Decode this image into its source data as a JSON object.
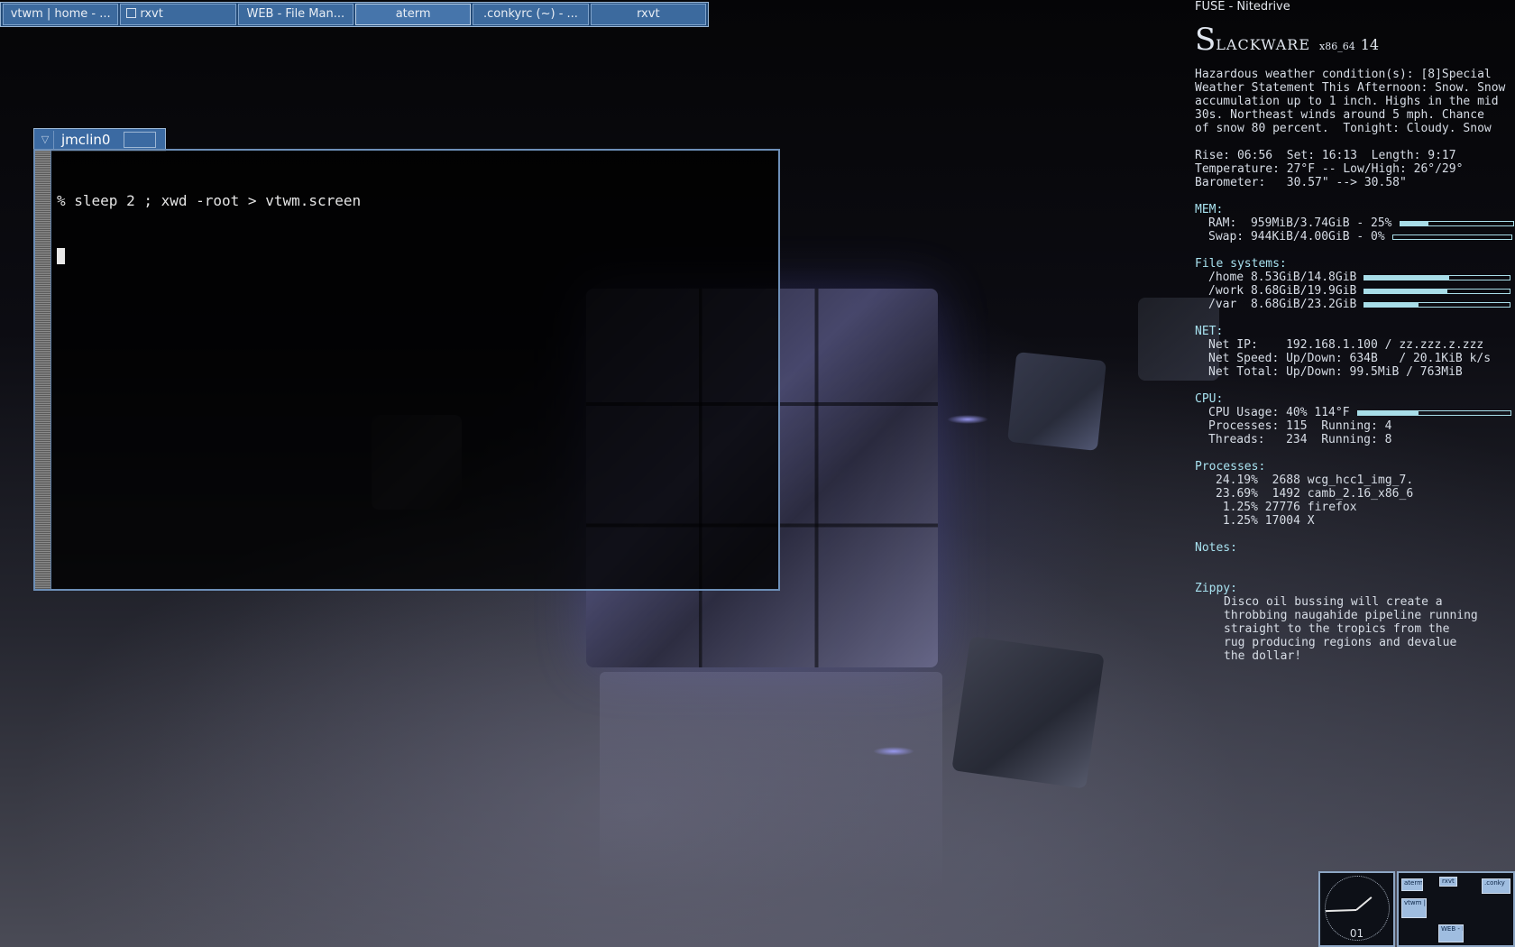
{
  "taskbar": {
    "items": [
      {
        "label": "vtwm | home - ..."
      },
      {
        "label": "rxvt"
      },
      {
        "label": "WEB - File Man..."
      },
      {
        "label": "aterm"
      },
      {
        "label": ".conkyrc (~) - ..."
      },
      {
        "label": "rxvt"
      }
    ]
  },
  "terminal": {
    "title": "jmclin0",
    "command_line": "% sleep 2 ; xwd -root > vtwm.screen"
  },
  "conky": {
    "top_label": "FUSE - Nitedrive",
    "logo": {
      "initial": "S",
      "name": "LACKWARE",
      "arch": "x86_64",
      "version": "14"
    },
    "weather_lines": [
      "Hazardous weather condition(s): [8]Special",
      "Weather Statement This Afternoon: Snow. Snow",
      "accumulation up to 1 inch. Highs in the mid",
      "30s. Northeast winds around 5 mph. Chance",
      "of snow 80 percent.  Tonight: Cloudy. Snow"
    ],
    "sun_line": "Rise: 06:56  Set: 16:13  Length: 9:17",
    "temp_line": "Temperature: 27°F -- Low/High: 26°/29°",
    "baro_line": "Barometer:   30.57\" --> 30.58\"",
    "mem_header": "MEM:",
    "ram_text": "RAM:  959MiB/3.74GiB - 25%",
    "ram_fraction": 0.25,
    "swap_text": "Swap: 944KiB/4.00GiB - 0%",
    "swap_fraction": 0.0,
    "fs_header": "File systems:",
    "fs": [
      {
        "text": "/home 8.53GiB/14.8GiB",
        "fraction": 0.58
      },
      {
        "text": "/work 8.68GiB/19.9GiB",
        "fraction": 0.57
      },
      {
        "text": "/var  8.68GiB/23.2GiB",
        "fraction": 0.37
      }
    ],
    "net_header": "NET:",
    "net_lines": [
      "Net IP:    192.168.1.100 / zz.zzz.z.zzz",
      "Net Speed: Up/Down: 634B   / 20.1KiB k/s",
      "Net Total: Up/Down: 99.5MiB / 763MiB"
    ],
    "cpu_header": "CPU:",
    "cpu_usage_text": "CPU Usage: 40% 114°F",
    "cpu_fraction": 0.4,
    "cpu_lines": [
      "Processes: 115  Running: 4",
      "Threads:   234  Running: 8"
    ],
    "procs_header": "Processes:",
    "procs": [
      "24.19%  2688 wcg_hcc1_img_7.",
      "23.69%  1492 camb_2.16_x86_6",
      " 1.25% 27776 firefox",
      " 1.25% 17004 X"
    ],
    "notes_header": "Notes:",
    "zippy_header": "Zippy:",
    "zippy_lines": [
      "Disco oil bussing will create a",
      "throbbing naugahide pipeline running",
      "straight to the tropics from the",
      "rug producing regions and devalue",
      "the dollar!"
    ]
  },
  "clock": {
    "label": "01"
  },
  "pager": {
    "windows": [
      {
        "label": "aterm"
      },
      {
        "label": "rxvt"
      },
      {
        "label": ".conky"
      },
      {
        "label": "vtwm |"
      },
      {
        "label": "WEB - F"
      }
    ]
  },
  "colors": {
    "taskbar": "#244b78",
    "conky_header": "#a8e2f0",
    "bar": "#a8dde8"
  }
}
